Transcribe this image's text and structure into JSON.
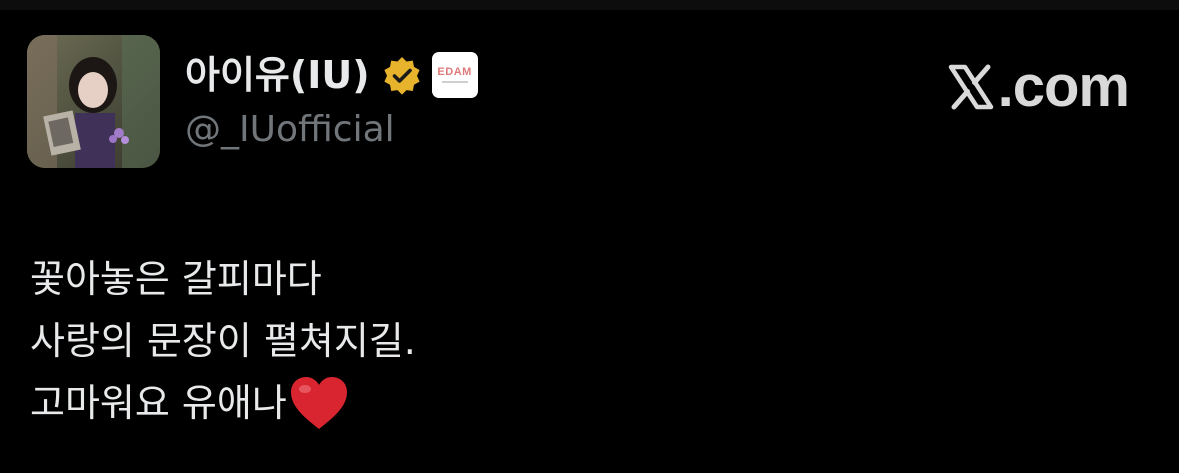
{
  "author": {
    "display_name": "아이유(IU)",
    "handle": "@_IUofficial",
    "verified_color": "#e8b32c",
    "affiliate_badge_text": "EDAM"
  },
  "brand": {
    "logo_icon": "x-logo-icon",
    "text": ".com"
  },
  "tweet": {
    "lines": [
      "꽃아놓은 갈피마다",
      "사랑의 문장이 펼쳐지길.",
      "고마워요 유애나"
    ],
    "emoji": "heart-icon",
    "emoji_color": "#d9252f"
  },
  "colors": {
    "background": "#000000",
    "primary_text": "#e7e9ea",
    "secondary_text": "#71767b"
  }
}
